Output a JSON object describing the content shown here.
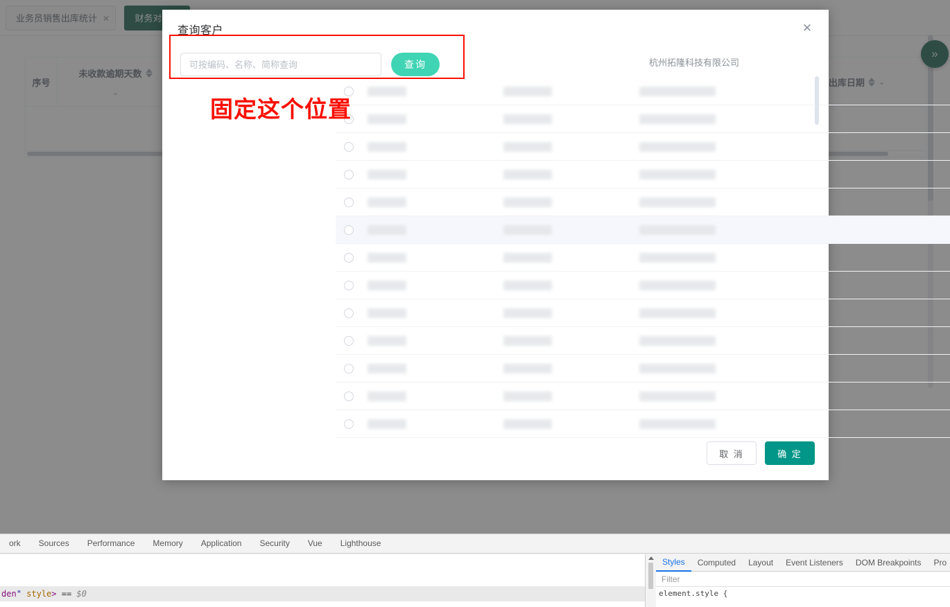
{
  "app": {
    "tabs": [
      {
        "label": "业务员销售出库统计",
        "close_icon": "close-icon",
        "active": false
      },
      {
        "label": "财务对账组",
        "active": true
      }
    ],
    "table_headers": {
      "seq": "序号",
      "overdue_days": "未收款逾期天数",
      "out_date": "出库日期"
    },
    "fab_glyph": "»"
  },
  "dialog": {
    "title": "查询客户",
    "close_glyph": "✕",
    "search": {
      "placeholder": "可按编码、名称、简称查询",
      "value": "",
      "button_label": "查询"
    },
    "company": "杭州拓隆科技有限公司",
    "annotation": "固定这个位置",
    "rows": [
      {
        "selected": false,
        "highlight": false
      },
      {
        "selected": false,
        "highlight": false
      },
      {
        "selected": false,
        "highlight": false
      },
      {
        "selected": false,
        "highlight": false
      },
      {
        "selected": false,
        "highlight": true
      },
      {
        "selected": false,
        "highlight": false
      },
      {
        "selected": false,
        "highlight": false
      },
      {
        "selected": false,
        "highlight": false
      },
      {
        "selected": false,
        "highlight": false
      },
      {
        "selected": false,
        "highlight": false
      },
      {
        "selected": false,
        "highlight": false
      },
      {
        "selected": false,
        "highlight": false
      },
      {
        "selected": false,
        "highlight": false
      }
    ],
    "footer": {
      "cancel_label": "取 消",
      "confirm_label": "确 定"
    }
  },
  "devtools": {
    "tabs": [
      "ork",
      "Sources",
      "Performance",
      "Memory",
      "Application",
      "Security",
      "Vue",
      "Lighthouse"
    ],
    "console_line": {
      "part1": "den",
      "part2": "\"",
      "part3": " style",
      "part4": ">",
      "part5": " == ",
      "part6": "$0"
    },
    "right_tabs": [
      "Styles",
      "Computed",
      "Layout",
      "Event Listeners",
      "DOM Breakpoints",
      "Pro"
    ],
    "right_active_tab": "Styles",
    "filter_placeholder": "Filter",
    "style_rule": "element.style {"
  },
  "colors": {
    "brand_dark_green": "#0a5742",
    "teal_button": "#3fd4b4",
    "confirm_green": "#029688",
    "annotation_red": "#fa0f00",
    "devtools_accent": "#1a73e8"
  }
}
